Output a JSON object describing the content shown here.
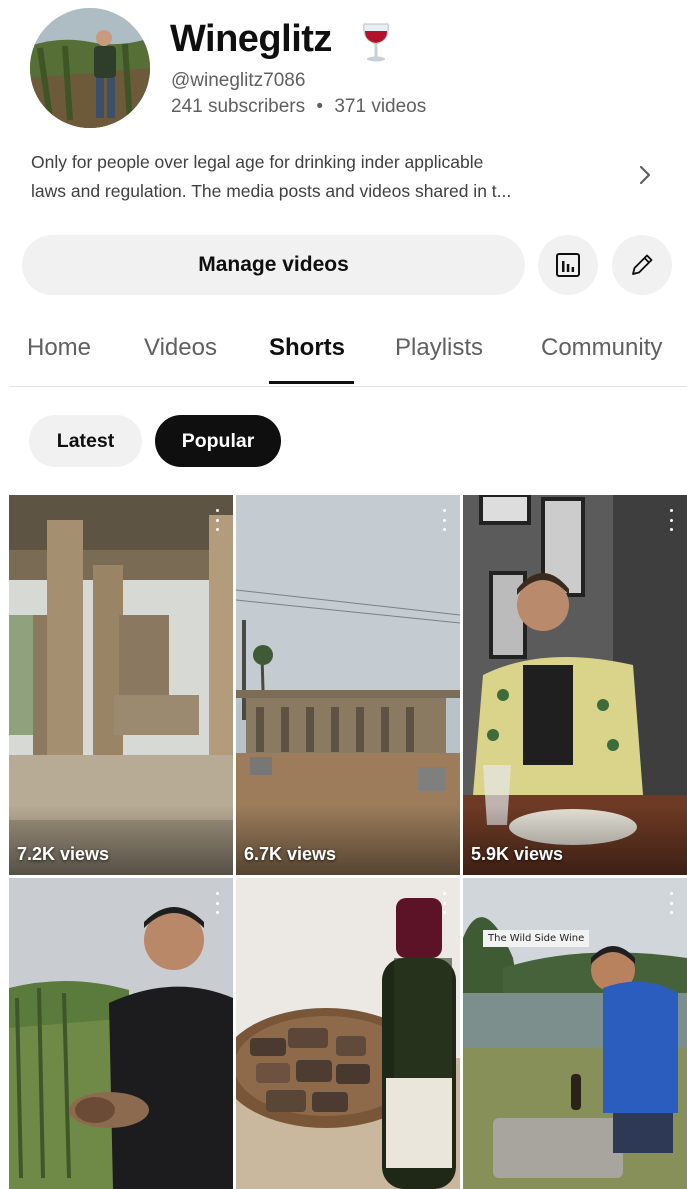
{
  "channel": {
    "name": "Wineglitz",
    "handle": "@wineglitz7086",
    "subscribers": "241 subscribers",
    "separator": "•",
    "videos": "371 videos",
    "description_line1": "Only for people over legal age for drinking inder applicable",
    "description_line2": "laws and regulation. The media posts and videos shared in t..."
  },
  "actions": {
    "manage_videos": "Manage videos"
  },
  "tabs": [
    {
      "label": "Home"
    },
    {
      "label": "Videos"
    },
    {
      "label": "Shorts",
      "active": true
    },
    {
      "label": "Playlists"
    },
    {
      "label": "Community"
    }
  ],
  "chips": [
    {
      "label": "Latest",
      "selected": false
    },
    {
      "label": "Popular",
      "selected": true
    }
  ],
  "shorts": [
    {
      "views": "7.2K views"
    },
    {
      "views": "6.7K views"
    },
    {
      "views": "5.9K views"
    },
    {
      "views": ""
    },
    {
      "views": ""
    },
    {
      "views": "",
      "overlay_text": "The Wild Side Wine"
    }
  ],
  "icons": {
    "analytics": "bar-chart-icon",
    "edit": "pencil-icon",
    "more": "chevron-right-icon",
    "wine": "wine-glass-emoji"
  },
  "colors": {
    "text_primary": "#0f0f0f",
    "text_secondary": "#606060",
    "chip_bg": "#f1f1f1",
    "chip_selected_bg": "#0f0f0f"
  }
}
